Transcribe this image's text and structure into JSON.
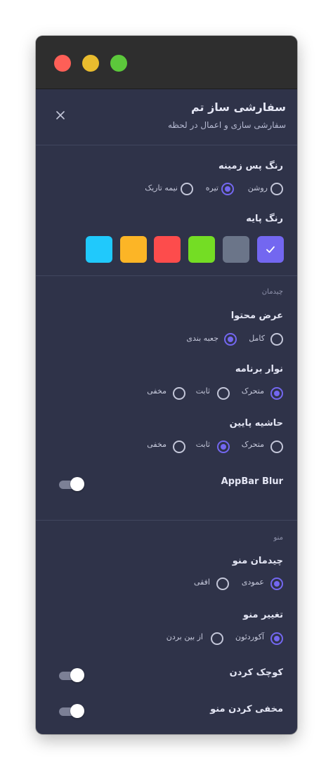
{
  "header": {
    "title": "سفارشی ساز تم",
    "subtitle": "سفارشی سازی و اعمال در لحظه"
  },
  "background_color": {
    "label": "رنگ پس زمینه",
    "options": [
      "روشن",
      "تیره",
      "نیمه تاریک"
    ],
    "selected": "تیره"
  },
  "base_color": {
    "label": "رنگ پایه",
    "swatches": [
      "#7367f0",
      "#6b7589",
      "#74dd24",
      "#fd4c4c",
      "#fcb526",
      "#20c9fc"
    ],
    "selected": "#7367f0"
  },
  "layout": {
    "section_title": "چیدمان",
    "content_width": {
      "label": "عرض محتوا",
      "options": [
        "کامل",
        "جعبه بندی"
      ],
      "selected": "جعبه بندی"
    },
    "app_bar": {
      "label": "نوار برنامه",
      "options": [
        "متحرک",
        "ثابت",
        "مخفی"
      ],
      "selected": "متحرک"
    },
    "footer": {
      "label": "حاشیه پایین",
      "options": [
        "متحرک",
        "ثابت",
        "مخفی"
      ],
      "selected": "ثابت"
    },
    "appbar_blur": {
      "label": "AppBar Blur",
      "enabled": true
    }
  },
  "menu": {
    "section_title": "منو",
    "menu_layout": {
      "label": "چیدمان منو",
      "options": [
        "عمودی",
        "افقی"
      ],
      "selected": "عمودی"
    },
    "menu_toggle": {
      "label": "تغییر منو",
      "options": [
        "آکوردئون",
        "از بین بردن"
      ],
      "selected": "آکوردئون"
    },
    "collapse": {
      "label": "کوچک کردن",
      "enabled": true
    },
    "hide": {
      "label": "مخفی کردن منو",
      "enabled": true
    }
  }
}
